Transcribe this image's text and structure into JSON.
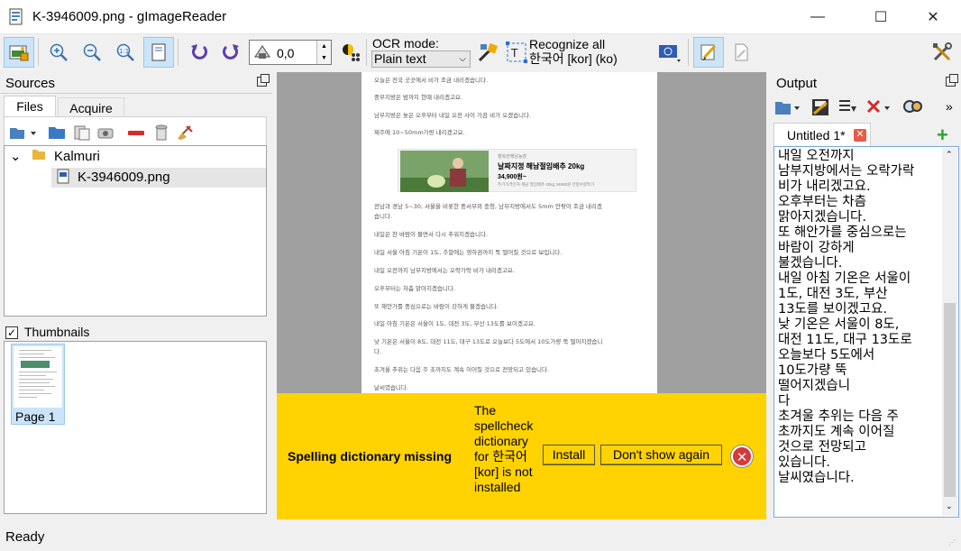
{
  "window": {
    "title": "K-3946009.png - gImageReader",
    "minimize": "—",
    "maximize": "☐",
    "close": "✕"
  },
  "toolbar": {
    "zoom_value": "0,0",
    "ocr_mode_label": "OCR mode:",
    "ocr_mode_value": "Plain text",
    "recognize_label": "Recognize all",
    "recognize_language": "한국어 [kor] (ko)"
  },
  "sources": {
    "title": "Sources",
    "tabs": [
      "Files",
      "Acquire"
    ],
    "tree": {
      "folder": "Kalmuri",
      "file": "K-3946009.png"
    },
    "thumbnails_label": "Thumbnails",
    "thumbnails_checked": "✓",
    "thumbnail_page": "Page 1"
  },
  "document": {
    "lines": [
      "오늘은 전국 곳곳에서 비가 조금 내리겠습니다.",
      "중부지방은 밤까지 한때 내리겠고요.",
      "남부지방은 늦은 오후부터 내일 오전 사이 가끔 비가 오겠습니다.",
      "제주에 10~50mm가량 내리겠고요.",
      "전남과 경남 5~30, 서울을 비롯한 중서부와 충청, 남부지방에서도 5mm 안팎이 조금 내리겠",
      "습니다.",
      "내일은 찬 바람이 불면서 다시 추워지겠습니다.",
      "내일 서울 아침 기온이 1도, 주말에는 영하권까지 뚝 떨어질 것으로 보입니다.",
      "내일 오전까지 남부지방에서는 오락가락 비가 내리겠고요.",
      "오후부터는 차츰 맑아지겠습니다.",
      "또 해안가를 중심으로는 바람이 강하게 불겠습니다.",
      "내일 아침 기온은 서울이 1도, 대전 3도, 부산 13도를 보이겠고요.",
      "낮 기온은 서울이 8도, 대전 11도, 대구 13도로 오늘보다 5도에서 10도가량 뚝 떨어지겠습니",
      "다.",
      "초겨울 추위는 다음 주 초까지도 계속 이어질 것으로 전망되고 있습니다.",
      "날씨였습니다."
    ],
    "ad": {
      "brand": "행복한해남농장",
      "product": "날짜지정 해남절임배추 20kg",
      "price": "34,900원~",
      "desc": "주기가격인하 해남 절임배추 20kg 34900원 안정수량특가"
    }
  },
  "infobar": {
    "title": "Spelling dictionary missing",
    "message": "The spellcheck dictionary for 한국어 [kor] is not installed",
    "install": "Install",
    "dont_show": "Don't show again",
    "close_icon": "✕"
  },
  "output": {
    "title": "Output",
    "tab_label": "Untitled 1*",
    "tab_close": "✕",
    "add_tab": "+",
    "overflow": "»",
    "text": "내일 오전까지\n남부지방에서는 오락가락\n비가 내리겠고요.\n오후부터는 차츰\n맑아지겠습니다.\n또 해안가를 중심으로는\n바람이 강하게\n불겠습니다.\n내일 아침 기온은 서울이\n1도, 대전 3도, 부산\n13도를 보이겠고요.\n낮 기온은 서울이 8도,\n대전 11도, 대구 13도로\n오늘보다 5도에서\n10도가량 뚝\n떨어지겠습니\n다\n초겨울 추위는 다음 주\n초까지도 계속 이어질\n것으로 전망되고\n있습니다.\n날씨였습니다."
  },
  "status": {
    "text": "Ready"
  },
  "colors": {
    "infobar": "#ffd200",
    "active_button": "#cce4f7",
    "selection": "#e5e5e5"
  }
}
